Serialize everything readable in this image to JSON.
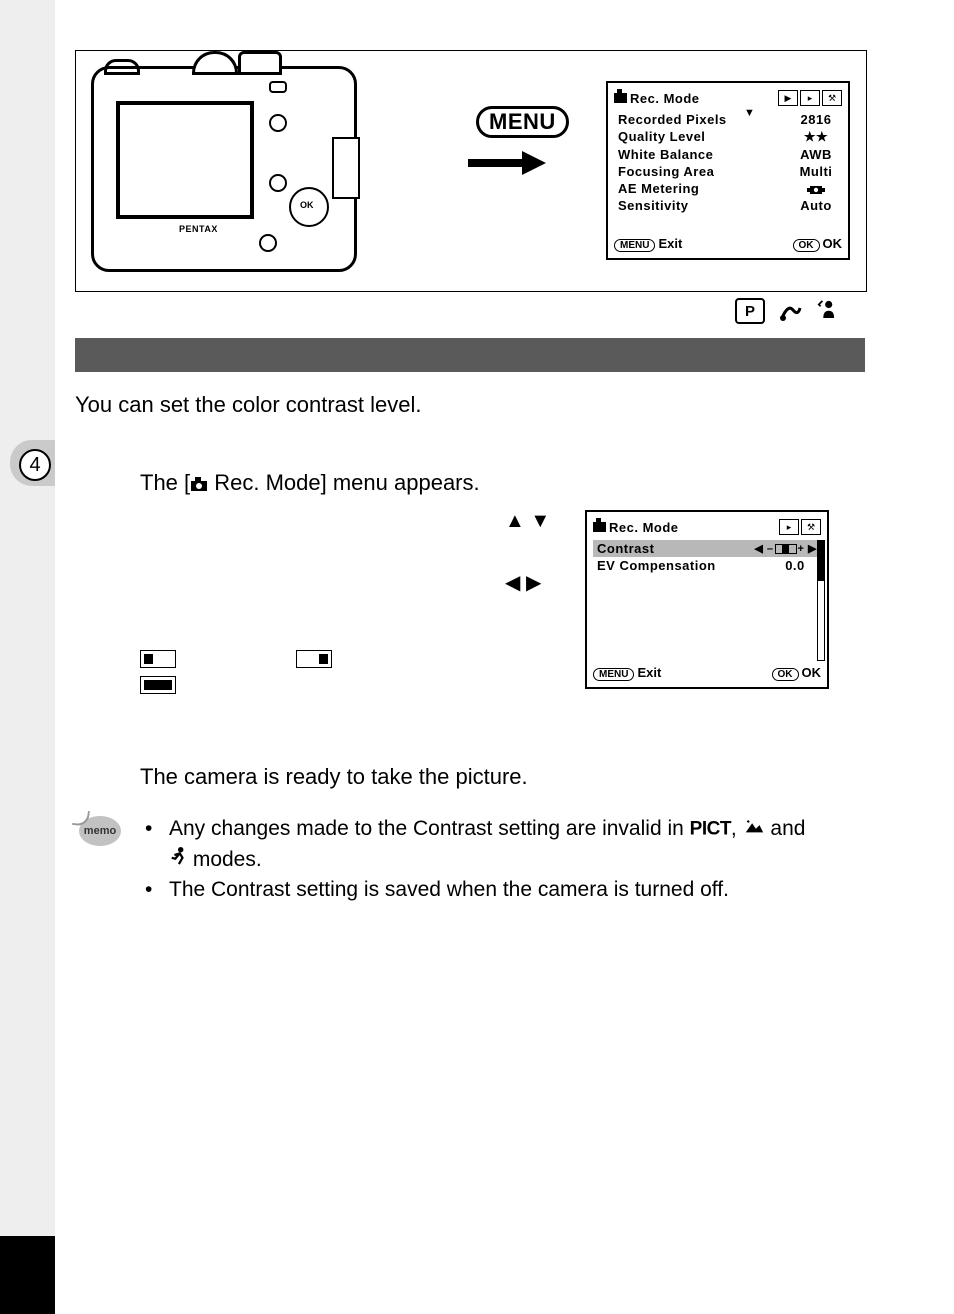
{
  "sidebar": {
    "tab_number": "4"
  },
  "top_illustration": {
    "camera_brand": "PENTAX",
    "menu_label": "MENU"
  },
  "lcd_menu_1": {
    "title": "Rec. Mode",
    "items": [
      {
        "label": "Recorded Pixels",
        "value": "2816"
      },
      {
        "label": "Quality Level",
        "value": "★★"
      },
      {
        "label": "White Balance",
        "value": "AWB"
      },
      {
        "label": "Focusing Area",
        "value": "Multi"
      },
      {
        "label": "AE Metering",
        "value": "◙"
      },
      {
        "label": "Sensitivity",
        "value": "Auto"
      }
    ],
    "footer_menu": "MENU",
    "footer_exit": "Exit",
    "footer_ok": "OK",
    "footer_ok_label": "OK"
  },
  "mode_icons": {
    "p": "P"
  },
  "intro_text": "You can set the color contrast level.",
  "step1_line": "The [  Rec. Mode] menu appears.",
  "step3_line": "The camera is ready to take the picture.",
  "lcd_menu_2": {
    "title": "Rec. Mode",
    "items": [
      {
        "label": "Contrast",
        "highlighted": true
      },
      {
        "label": "EV Compensation",
        "value": "0.0"
      }
    ],
    "footer_menu": "MENU",
    "footer_exit": "Exit",
    "footer_ok": "OK",
    "footer_ok_label": "OK"
  },
  "memo": {
    "label": "memo",
    "items": [
      {
        "pre": "Any changes made to the Contrast setting are invalid in ",
        "mid": ",  ",
        "post": " and",
        "line2": " modes."
      },
      {
        "text": "The Contrast setting is saved when the camera is turned off."
      }
    ],
    "pict": "PICT"
  }
}
